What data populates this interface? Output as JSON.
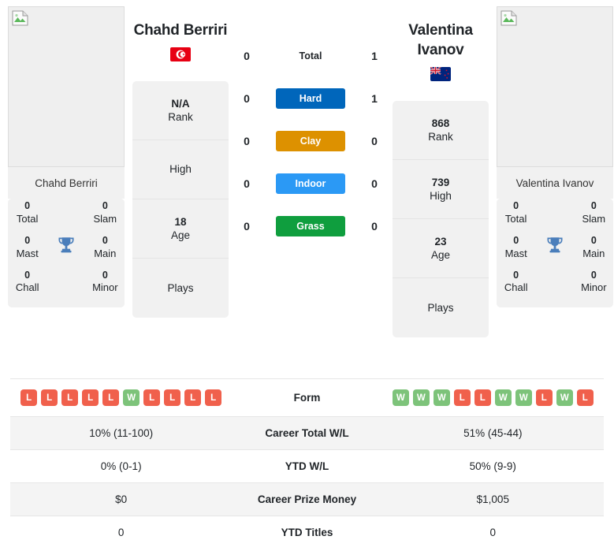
{
  "players": {
    "left": {
      "name": "Chahd Berriri",
      "photo_caption": "Chahd Berriri",
      "flag": "tunisia-flag",
      "rank": "N/A",
      "rank_label": "Rank",
      "high": "",
      "high_label": "High",
      "age": "18",
      "age_label": "Age",
      "plays": "",
      "plays_label": "Plays",
      "titles": {
        "total": "0",
        "total_label": "Total",
        "slam": "0",
        "slam_label": "Slam",
        "mast": "0",
        "mast_label": "Mast",
        "main": "0",
        "main_label": "Main",
        "chall": "0",
        "chall_label": "Chall",
        "minor": "0",
        "minor_label": "Minor"
      },
      "form": [
        "L",
        "L",
        "L",
        "L",
        "L",
        "W",
        "L",
        "L",
        "L",
        "L"
      ],
      "career_total_wl": "10% (11-100)",
      "ytd_wl": "0% (0-1)",
      "career_prize_money": "$0",
      "ytd_titles": "0"
    },
    "right": {
      "name": "Valentina Ivanov",
      "photo_caption": "Valentina Ivanov",
      "flag": "new-zealand-flag",
      "rank": "868",
      "rank_label": "Rank",
      "high": "739",
      "high_label": "High",
      "age": "23",
      "age_label": "Age",
      "plays": "",
      "plays_label": "Plays",
      "titles": {
        "total": "0",
        "total_label": "Total",
        "slam": "0",
        "slam_label": "Slam",
        "mast": "0",
        "mast_label": "Mast",
        "main": "0",
        "main_label": "Main",
        "chall": "0",
        "chall_label": "Chall",
        "minor": "0",
        "minor_label": "Minor"
      },
      "form": [
        "W",
        "W",
        "W",
        "L",
        "L",
        "W",
        "W",
        "L",
        "W",
        "L"
      ],
      "career_total_wl": "51% (45-44)",
      "ytd_wl": "50% (9-9)",
      "career_prize_money": "$1,005",
      "ytd_titles": "0"
    }
  },
  "head_to_head": [
    {
      "label": "Total",
      "left": "0",
      "right": "1",
      "color": "",
      "styled": false
    },
    {
      "label": "Hard",
      "left": "0",
      "right": "1",
      "color": "#0066bb",
      "styled": true
    },
    {
      "label": "Clay",
      "left": "0",
      "right": "0",
      "color": "#dd9100",
      "styled": true
    },
    {
      "label": "Indoor",
      "left": "0",
      "right": "0",
      "color": "#2b99f5",
      "styled": true
    },
    {
      "label": "Grass",
      "left": "0",
      "right": "0",
      "color": "#0f9e3e",
      "styled": true
    }
  ],
  "table_rows": [
    {
      "label": "Form",
      "key": "form",
      "type": "form"
    },
    {
      "label": "Career Total W/L",
      "key": "career_total_wl",
      "type": "text"
    },
    {
      "label": "YTD W/L",
      "key": "ytd_wl",
      "type": "text"
    },
    {
      "label": "Career Prize Money",
      "key": "career_prize_money",
      "type": "text"
    },
    {
      "label": "YTD Titles",
      "key": "ytd_titles",
      "type": "text"
    }
  ],
  "colors": {
    "hard": "#0066bb",
    "clay": "#dd9100",
    "indoor": "#2b99f5",
    "grass": "#0f9e3e",
    "win": "#7dc37a",
    "loss": "#f0604c",
    "trophy": "#4a7ebb",
    "panel": "#f1f1f1"
  }
}
